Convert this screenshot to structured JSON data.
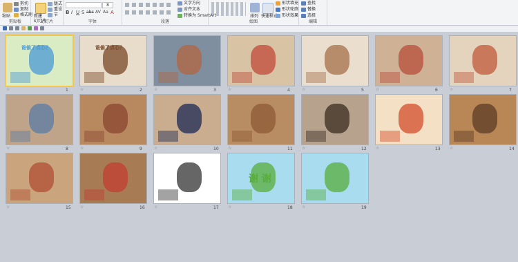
{
  "ribbon": {
    "clipboard": {
      "paste": "粘贴",
      "cut": "剪切",
      "copy": "复制",
      "format_painter": "格式刷",
      "label": "剪贴板"
    },
    "slides": {
      "new_slide": "新建\n幻灯片",
      "layout": "版式",
      "reset": "重设",
      "section": "节",
      "label": "幻灯片"
    },
    "font": {
      "label": "字体",
      "size": "8",
      "format_buttons": [
        "B",
        "I",
        "U",
        "S",
        "abc",
        "AV",
        "Aa",
        "A"
      ]
    },
    "paragraph": {
      "label": "段落",
      "text_direction": "文字方向",
      "align_text": "对齐文本",
      "smartart": "转换为 SmartArt"
    },
    "drawing": {
      "label": "绘图",
      "arrange": "排列",
      "quick_styles": "快速样式",
      "shape_fill": "形状填充",
      "shape_outline": "形状轮廓",
      "shape_effects": "形状效果"
    },
    "editing": {
      "label": "编辑",
      "find": "查找",
      "replace": "替换",
      "select": "选择"
    }
  },
  "slides": [
    {
      "n": "1",
      "bg": "#d9ecc4",
      "accent": "#4a9ad4",
      "title": "谁偷了点心？",
      "selected": true
    },
    {
      "n": "2",
      "bg": "#e8dccb",
      "accent": "#7a4a2a",
      "title": "谁偷了点心？",
      "selected": false
    },
    {
      "n": "3",
      "bg": "#7f8fa0",
      "accent": "#b2653f",
      "title": "",
      "selected": false
    },
    {
      "n": "4",
      "bg": "#d8c4a4",
      "accent": "#c14a3a",
      "title": "",
      "selected": false
    },
    {
      "n": "5",
      "bg": "#eadfce",
      "accent": "#a4704a",
      "title": "",
      "selected": false
    },
    {
      "n": "6",
      "bg": "#cfb296",
      "accent": "#b74c38",
      "title": "",
      "selected": false
    },
    {
      "n": "7",
      "bg": "#e4d3bd",
      "accent": "#c25a3c",
      "title": "",
      "selected": false
    },
    {
      "n": "8",
      "bg": "#bfa489",
      "accent": "#5b7ca4",
      "title": "",
      "selected": false
    },
    {
      "n": "9",
      "bg": "#b8895f",
      "accent": "#8a4630",
      "title": "",
      "selected": false
    },
    {
      "n": "10",
      "bg": "#c9ad8e",
      "accent": "#1c2a56",
      "title": "",
      "selected": false
    },
    {
      "n": "11",
      "bg": "#b88d64",
      "accent": "#8e5a34",
      "title": "",
      "selected": false
    },
    {
      "n": "12",
      "bg": "#b7a28d",
      "accent": "#3a2c22",
      "title": "",
      "selected": false
    },
    {
      "n": "13",
      "bg": "#f4e0c4",
      "accent": "#d34d2c",
      "title": "",
      "selected": false
    },
    {
      "n": "14",
      "bg": "#b98656",
      "accent": "#5e3b25",
      "title": "",
      "selected": false
    },
    {
      "n": "15",
      "bg": "#caa47c",
      "accent": "#b04e34",
      "title": "",
      "selected": false
    },
    {
      "n": "16",
      "bg": "#a77c55",
      "accent": "#c23d32",
      "title": "",
      "selected": false
    },
    {
      "n": "17",
      "bg": "#ffffff",
      "accent": "#333333",
      "title": "",
      "selected": false
    },
    {
      "n": "18",
      "bg": "#a9dcef",
      "accent": "#58ad3c",
      "title": "谢 谢",
      "selected": false
    },
    {
      "n": "19",
      "bg": "#a9dcef",
      "accent": "#58ad3c",
      "title": "",
      "selected": false
    }
  ]
}
